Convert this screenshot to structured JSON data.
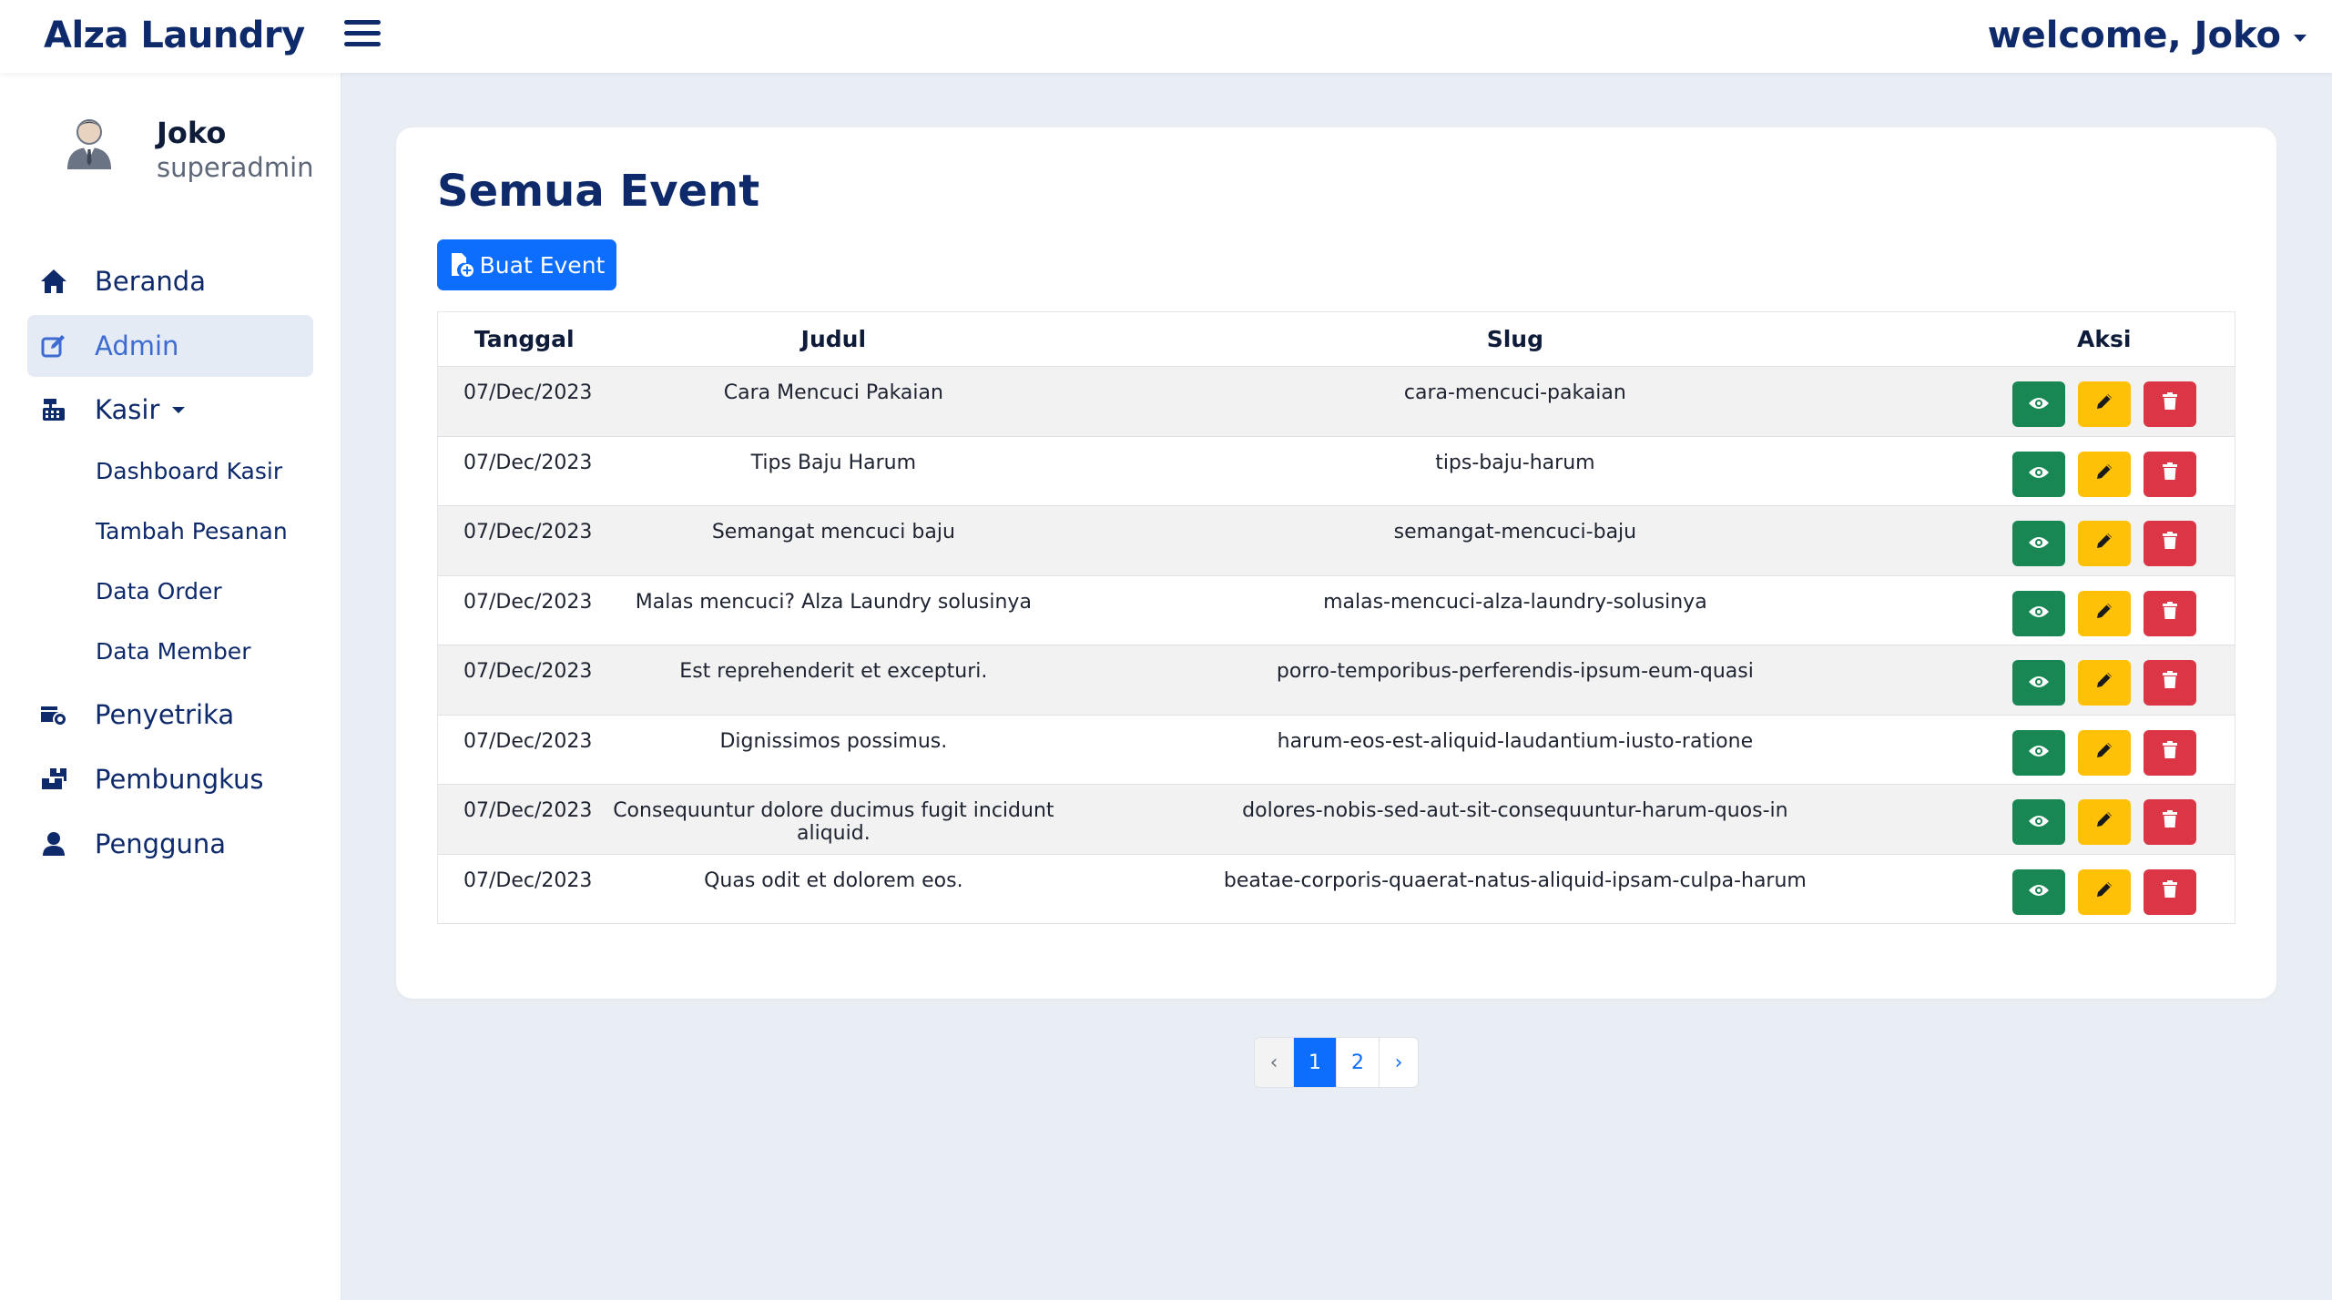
{
  "app": {
    "brand": "Alza Laundry",
    "welcome": "welcome, Joko"
  },
  "user": {
    "name": "Joko",
    "role": "superadmin"
  },
  "sidebar": {
    "items": [
      {
        "label": "Beranda",
        "icon": "home-icon"
      },
      {
        "label": "Admin",
        "icon": "edit-icon",
        "active": true
      },
      {
        "label": "Kasir",
        "icon": "cash-register-icon"
      },
      {
        "label": "Penyetrika",
        "icon": "iron-icon"
      },
      {
        "label": "Pembungkus",
        "icon": "package-icon"
      },
      {
        "label": "Pengguna",
        "icon": "user-icon"
      }
    ],
    "kasir_sub": [
      "Dashboard Kasir",
      "Tambah Pesanan",
      "Data Order",
      "Data Member"
    ]
  },
  "main": {
    "title": "Semua Event",
    "create_button": "Buat Event",
    "table": {
      "headers": [
        "Tanggal",
        "Judul",
        "Slug",
        "Aksi"
      ],
      "rows": [
        {
          "date": "07/Dec/2023",
          "judul": "Cara Mencuci Pakaian",
          "slug": "cara-mencuci-pakaian"
        },
        {
          "date": "07/Dec/2023",
          "judul": "Tips Baju Harum",
          "slug": "tips-baju-harum"
        },
        {
          "date": "07/Dec/2023",
          "judul": "Semangat mencuci baju",
          "slug": "semangat-mencuci-baju"
        },
        {
          "date": "07/Dec/2023",
          "judul": "Malas mencuci? Alza Laundry solusinya",
          "slug": "malas-mencuci-alza-laundry-solusinya"
        },
        {
          "date": "07/Dec/2023",
          "judul": "Est reprehenderit et excepturi.",
          "slug": "porro-temporibus-perferendis-ipsum-eum-quasi"
        },
        {
          "date": "07/Dec/2023",
          "judul": "Dignissimos possimus.",
          "slug": "harum-eos-est-aliquid-laudantium-iusto-ratione"
        },
        {
          "date": "07/Dec/2023",
          "judul": "Consequuntur dolore ducimus fugit incidunt aliquid.",
          "slug": "dolores-nobis-sed-aut-sit-consequuntur-harum-quos-in"
        },
        {
          "date": "07/Dec/2023",
          "judul": "Quas odit et dolorem eos.",
          "slug": "beatae-corporis-quaerat-natus-aliquid-ipsam-culpa-harum"
        }
      ]
    }
  },
  "pagination": {
    "prev": "‹",
    "pages": [
      "1",
      "2"
    ],
    "current": "1",
    "next": "›"
  },
  "colors": {
    "brand": "#0e2a6b",
    "primary": "#0d6efd",
    "view": "#198754",
    "edit": "#ffc107",
    "delete": "#dc3545",
    "background": "#e9eef5"
  }
}
